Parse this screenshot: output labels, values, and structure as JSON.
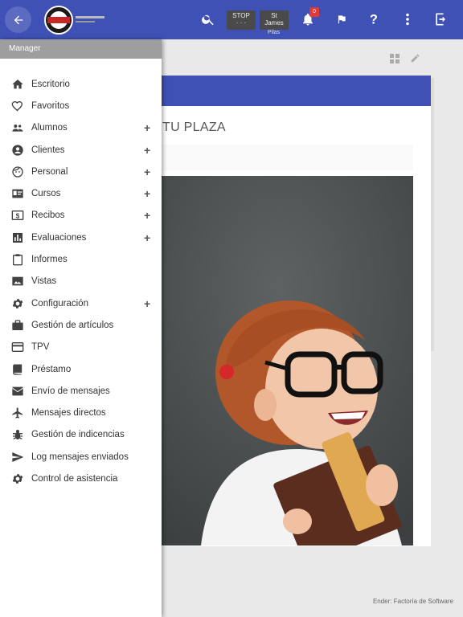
{
  "drawer": {
    "header": "Manager",
    "items": [
      {
        "label": "Escritorio",
        "icon": "home-icon",
        "expandable": false
      },
      {
        "label": "Favoritos",
        "icon": "heart-icon",
        "expandable": false
      },
      {
        "label": "Alumnos",
        "icon": "group-icon",
        "expandable": true
      },
      {
        "label": "Clientes",
        "icon": "account-circle-icon",
        "expandable": true
      },
      {
        "label": "Personal",
        "icon": "face-icon",
        "expandable": true
      },
      {
        "label": "Cursos",
        "icon": "id-card-icon",
        "expandable": true
      },
      {
        "label": "Recibos",
        "icon": "dollar-bill-icon",
        "expandable": true
      },
      {
        "label": "Evaluaciones",
        "icon": "bar-chart-icon",
        "expandable": true
      },
      {
        "label": "Informes",
        "icon": "clipboard-icon",
        "expandable": false
      },
      {
        "label": "Vistas",
        "icon": "image-icon",
        "expandable": false
      },
      {
        "label": "Configuración",
        "icon": "gear-icon",
        "expandable": true
      },
      {
        "label": "Gestión de artículos",
        "icon": "briefcase-icon",
        "expandable": false
      },
      {
        "label": "TPV",
        "icon": "credit-card-icon",
        "expandable": false
      },
      {
        "label": "Préstamo",
        "icon": "book-icon",
        "expandable": false
      },
      {
        "label": "Envío de mensajes",
        "icon": "envelope-icon",
        "expandable": false
      },
      {
        "label": "Mensajes directos",
        "icon": "airplane-icon",
        "expandable": false
      },
      {
        "label": "Gestión de indicencias",
        "icon": "bug-icon",
        "expandable": false
      },
      {
        "label": "Log mensajes enviados",
        "icon": "send-icon",
        "expandable": false
      },
      {
        "label": "Control de asistencia",
        "icon": "gear-icon",
        "expandable": false
      }
    ],
    "plus": "+"
  },
  "topbar": {
    "box1": {
      "line1": "STOP",
      "line2": "· · ·"
    },
    "box2": {
      "line1": "St",
      "line2": "James"
    },
    "box2_sub": "Pilas",
    "notifications": "0"
  },
  "main": {
    "card_title": "TU PLAZA"
  },
  "footer": {
    "credit": "Ender: Factoría de Software"
  },
  "colors": {
    "primary": "#3f51b5",
    "drawer_header": "#9e9e9e",
    "badge": "#e53935"
  }
}
